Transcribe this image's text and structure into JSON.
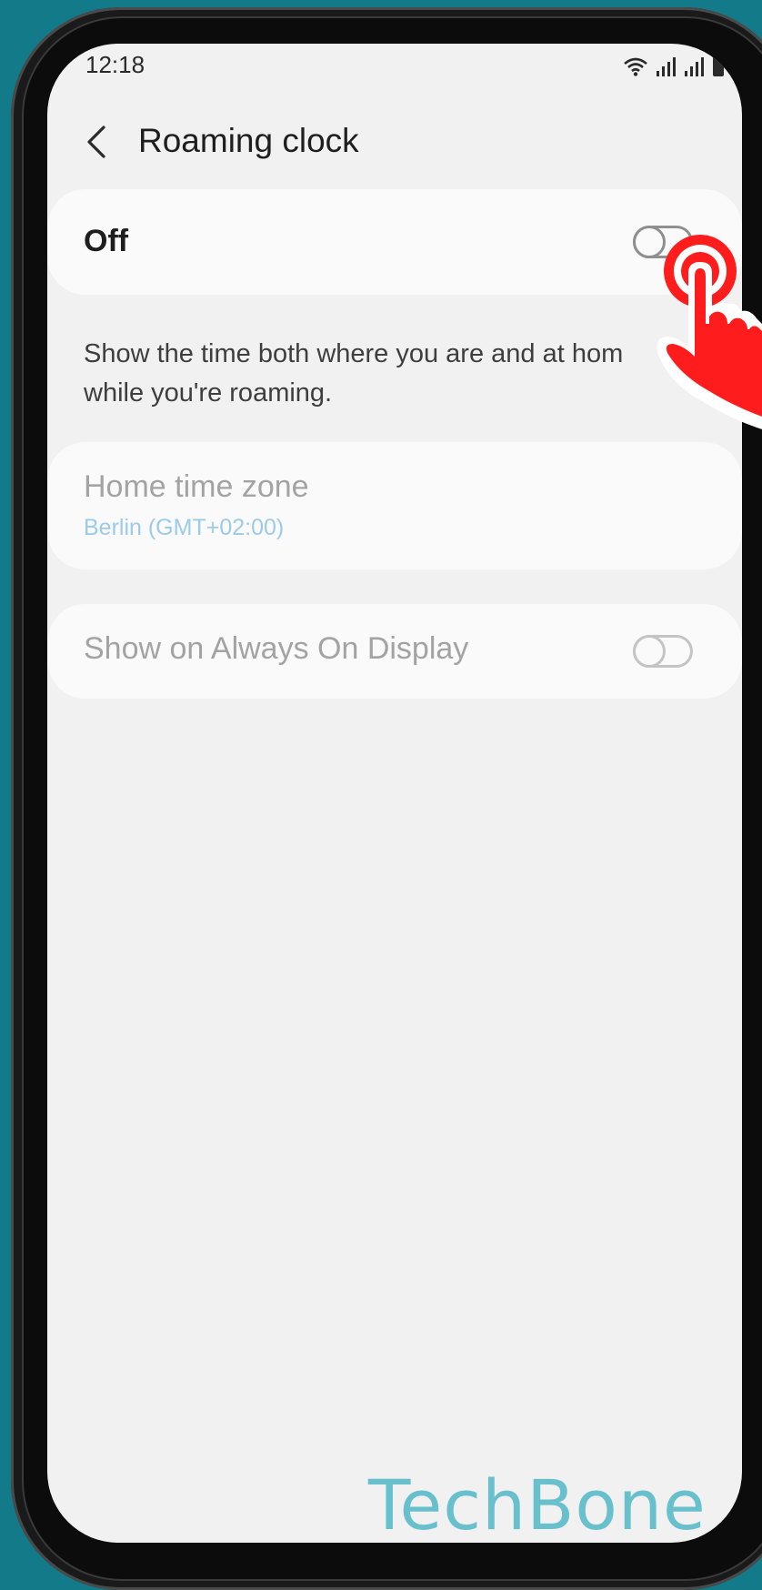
{
  "status_bar": {
    "time": "12:18"
  },
  "header": {
    "title": "Roaming clock"
  },
  "master_switch": {
    "label": "Off",
    "state": "off"
  },
  "description": {
    "line1": "Show the time both where you are and at hom",
    "line2": "while you're roaming."
  },
  "home_time_zone": {
    "title": "Home time zone",
    "value": "Berlin (GMT+02:00)"
  },
  "always_on_display": {
    "label": "Show on Always On Display",
    "state": "off"
  },
  "watermark": {
    "text": "TechBone"
  },
  "colors": {
    "background": "#137a8a",
    "screen": "#f1f1f1",
    "card": "#fafafa",
    "pointer": "#ff1c1c",
    "link": "#9ccbe9",
    "watermark": "#69c0cd"
  }
}
